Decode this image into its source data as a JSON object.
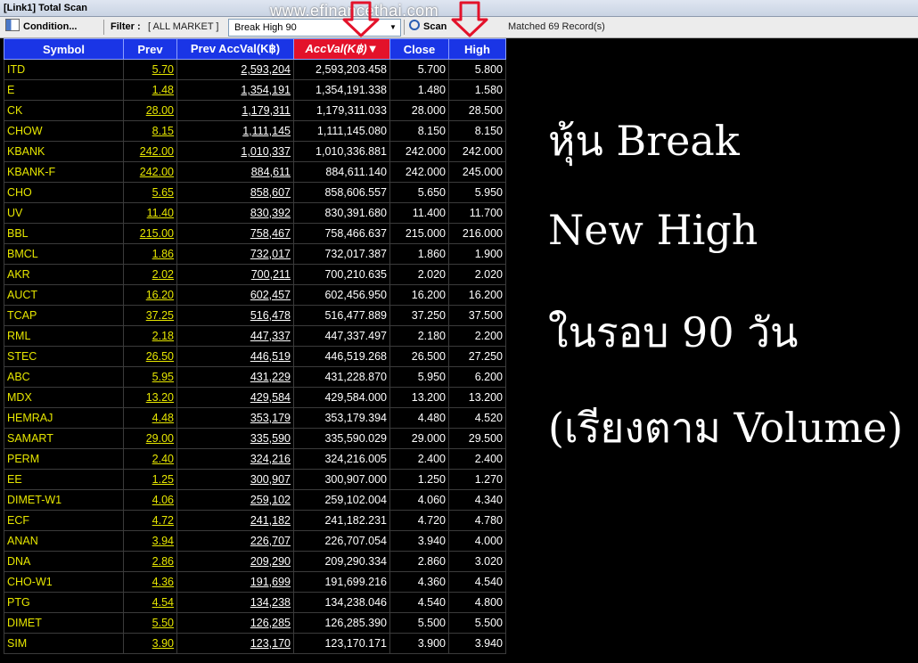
{
  "window": {
    "title": "[Link1] Total Scan"
  },
  "toolbar": {
    "condition_label": "Condition...",
    "filter_label": "Filter :",
    "filter_value": "[ ALL MARKET ]",
    "scan_select": "Break High 90",
    "scan_label": "Scan",
    "matched": "Matched 69 Record(s)"
  },
  "watermark": "www.efinancethai.com",
  "table": {
    "headers": [
      "Symbol",
      "Prev",
      "Prev AccVal(K฿)",
      "AccVal(K฿)",
      "Close",
      "High"
    ],
    "rows": [
      [
        "ITD",
        "5.70",
        "2,593,204",
        "2,593,203.458",
        "5.700",
        "5.800"
      ],
      [
        "E",
        "1.48",
        "1,354,191",
        "1,354,191.338",
        "1.480",
        "1.580"
      ],
      [
        "CK",
        "28.00",
        "1,179,311",
        "1,179,311.033",
        "28.000",
        "28.500"
      ],
      [
        "CHOW",
        "8.15",
        "1,111,145",
        "1,111,145.080",
        "8.150",
        "8.150"
      ],
      [
        "KBANK",
        "242.00",
        "1,010,337",
        "1,010,336.881",
        "242.000",
        "242.000"
      ],
      [
        "KBANK-F",
        "242.00",
        "884,611",
        "884,611.140",
        "242.000",
        "245.000"
      ],
      [
        "CHO",
        "5.65",
        "858,607",
        "858,606.557",
        "5.650",
        "5.950"
      ],
      [
        "UV",
        "11.40",
        "830,392",
        "830,391.680",
        "11.400",
        "11.700"
      ],
      [
        "BBL",
        "215.00",
        "758,467",
        "758,466.637",
        "215.000",
        "216.000"
      ],
      [
        "BMCL",
        "1.86",
        "732,017",
        "732,017.387",
        "1.860",
        "1.900"
      ],
      [
        "AKR",
        "2.02",
        "700,211",
        "700,210.635",
        "2.020",
        "2.020"
      ],
      [
        "AUCT",
        "16.20",
        "602,457",
        "602,456.950",
        "16.200",
        "16.200"
      ],
      [
        "TCAP",
        "37.25",
        "516,478",
        "516,477.889",
        "37.250",
        "37.500"
      ],
      [
        "RML",
        "2.18",
        "447,337",
        "447,337.497",
        "2.180",
        "2.200"
      ],
      [
        "STEC",
        "26.50",
        "446,519",
        "446,519.268",
        "26.500",
        "27.250"
      ],
      [
        "ABC",
        "5.95",
        "431,229",
        "431,228.870",
        "5.950",
        "6.200"
      ],
      [
        "MDX",
        "13.20",
        "429,584",
        "429,584.000",
        "13.200",
        "13.200"
      ],
      [
        "HEMRAJ",
        "4.48",
        "353,179",
        "353,179.394",
        "4.480",
        "4.520"
      ],
      [
        "SAMART",
        "29.00",
        "335,590",
        "335,590.029",
        "29.000",
        "29.500"
      ],
      [
        "PERM",
        "2.40",
        "324,216",
        "324,216.005",
        "2.400",
        "2.400"
      ],
      [
        "EE",
        "1.25",
        "300,907",
        "300,907.000",
        "1.250",
        "1.270"
      ],
      [
        "DIMET-W1",
        "4.06",
        "259,102",
        "259,102.004",
        "4.060",
        "4.340"
      ],
      [
        "ECF",
        "4.72",
        "241,182",
        "241,182.231",
        "4.720",
        "4.780"
      ],
      [
        "ANAN",
        "3.94",
        "226,707",
        "226,707.054",
        "3.940",
        "4.000"
      ],
      [
        "DNA",
        "2.86",
        "209,290",
        "209,290.334",
        "2.860",
        "3.020"
      ],
      [
        "CHO-W1",
        "4.36",
        "191,699",
        "191,699.216",
        "4.360",
        "4.540"
      ],
      [
        "PTG",
        "4.54",
        "134,238",
        "134,238.046",
        "4.540",
        "4.800"
      ],
      [
        "DIMET",
        "5.50",
        "126,285",
        "126,285.390",
        "5.500",
        "5.500"
      ],
      [
        "SIM",
        "3.90",
        "123,170",
        "123,170.171",
        "3.900",
        "3.940"
      ]
    ]
  },
  "sort_indicator": "▼",
  "overlay_text": [
    "หุ้น Break",
    "New High",
    "ในรอบ 90 วัน",
    "(เรียงตาม Volume)"
  ],
  "colors": {
    "header_bg": "#1a35e6",
    "active_header_bg": "#e3122a",
    "symbol_text": "#e6e600",
    "arrow": "#e3122a"
  }
}
